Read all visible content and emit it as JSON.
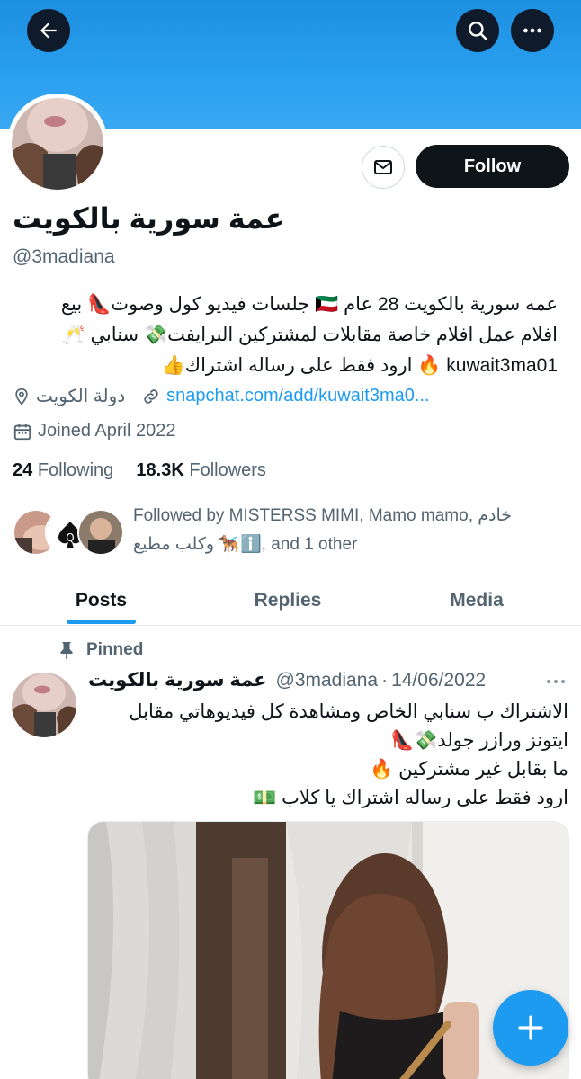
{
  "profile": {
    "name": "عمة سورية بالكويت",
    "handle": "@3madiana",
    "bio_lines": [
      "عمه سورية بالكويت 28 عام 🇰🇼 جلسات فيديو كول وصوت👠 بيع",
      "افلام عمل افلام خاصة مقابلات لمشتركين البرايفت💸 سنابي 🥂",
      "kuwait3ma01 🔥 ارود فقط على رساله اشتراك👍"
    ],
    "location": "دولة الكويت",
    "website": "snapchat.com/add/kuwait3ma0...",
    "joined": "Joined April 2022",
    "following_count": "24",
    "following_label": "Following",
    "followers_count": "18.3K",
    "followers_label": "Followers",
    "followed_by_line1": "Followed by MISTERSS MIMI, Mamo mamo, خادم",
    "followed_by_line2": "وكلب مطيع 🐕‍🦺ℹ️, and 1 other"
  },
  "buttons": {
    "follow": "Follow"
  },
  "tabs": [
    {
      "label": "Posts",
      "active": true
    },
    {
      "label": "Replies",
      "active": false
    },
    {
      "label": "Media",
      "active": false
    }
  ],
  "post": {
    "pinned_label": "Pinned",
    "author_name": "عمة سورية بالكويت",
    "author_handle": "@3madiana",
    "separator": "·",
    "date": "14/06/2022",
    "text_lines": [
      "الاشتراك ب سنابي الخاص ومشاهدة كل فيديوهاتي مقابل",
      "ايتونز ورازر جولد💸👠",
      "ما بقابل غير مشتركين 🔥",
      "ارود فقط على رساله اشتراك يا كلاب 💵"
    ]
  },
  "icons": {
    "back": "arrow-left-icon",
    "search": "search-icon",
    "more": "more-horizontal-icon",
    "message": "envelope-icon",
    "location": "location-pin-icon",
    "link": "link-icon",
    "calendar": "calendar-icon",
    "pin": "pin-icon",
    "compose": "plus-icon"
  },
  "colors": {
    "accent": "#1d9bf0",
    "banner": "#2aa0f0",
    "text_primary": "#0f1419",
    "text_secondary": "#536471",
    "follow_bg": "#0f1419"
  }
}
